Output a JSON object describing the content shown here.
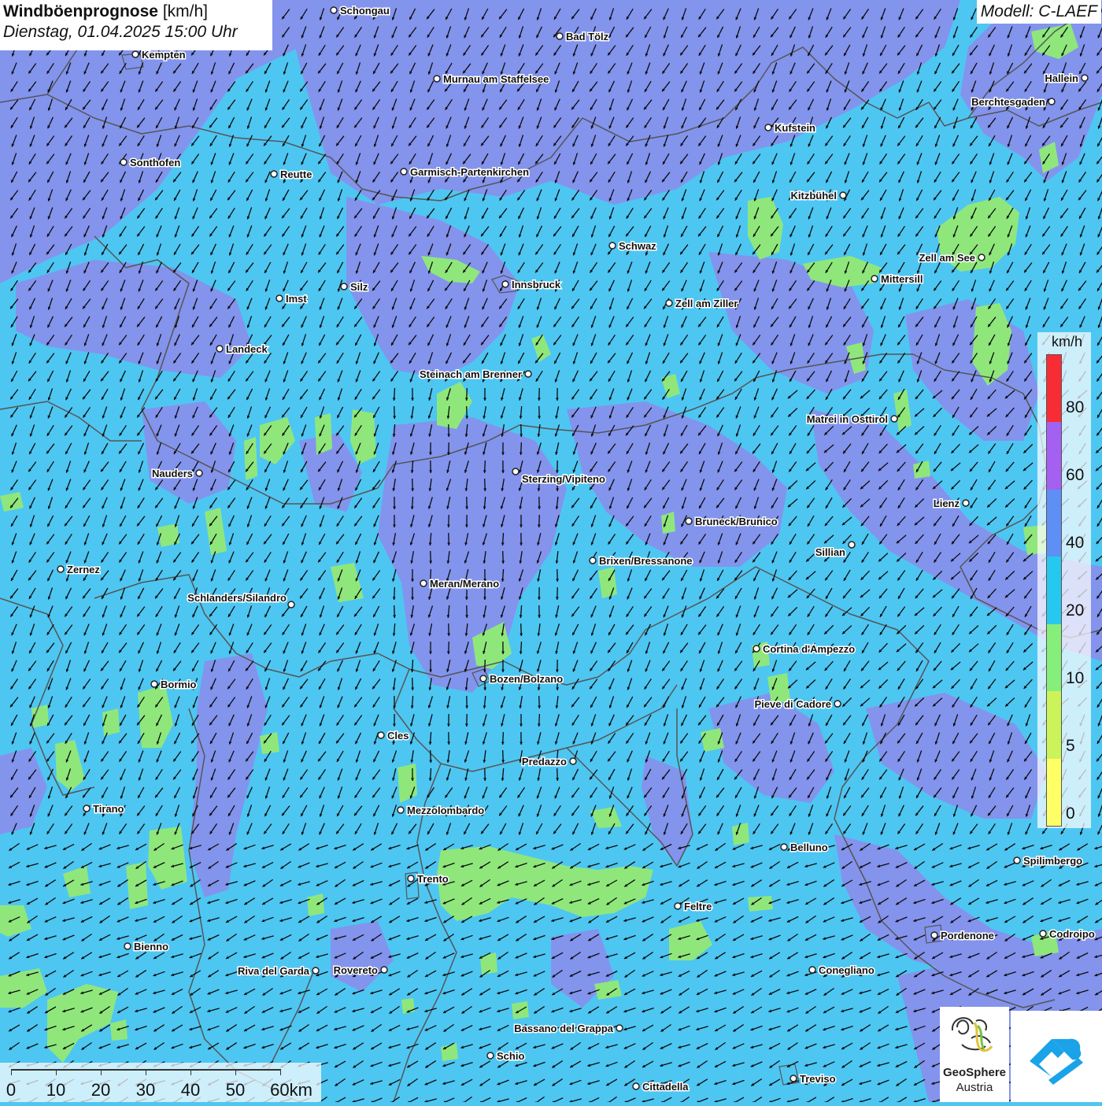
{
  "title": {
    "bold": "Windböenprognose",
    "unit": "[km/h]",
    "datetime": "Dienstag, 01.04.2025 15:00 Uhr"
  },
  "model": "Modell: C-LAEF",
  "legend": {
    "unit": "km/h",
    "labels": [
      "80",
      "60",
      "40",
      "20",
      "10",
      "5",
      "0"
    ],
    "segment_colors": [
      "#f72c35",
      "#a460f0",
      "#5d8ff5",
      "#27c8f0",
      "#86ee7a",
      "#cbf45a",
      "#ffff66"
    ]
  },
  "scale": {
    "labels": [
      "0",
      "10",
      "20",
      "30",
      "40",
      "50",
      "60km"
    ]
  },
  "colors": {
    "base": "#4ec6f2",
    "band_20_40": "#8a8eec",
    "band_10_20": "#8fe77c",
    "border": "#555555"
  },
  "wind_arrow_icon": "arrow-southwest",
  "logo": {
    "line1": "GeoSphere",
    "line2": "Austria"
  },
  "cities": [
    {
      "name": "Schongau"
    },
    {
      "name": "Bad Tölz"
    },
    {
      "name": "Kempten"
    },
    {
      "name": "Murnau am Staffelsee"
    },
    {
      "name": "Hallein"
    },
    {
      "name": "Berchtesgaden"
    },
    {
      "name": "Kufstein"
    },
    {
      "name": "Sonthofen"
    },
    {
      "name": "Reutte"
    },
    {
      "name": "Garmisch-Partenkirchen"
    },
    {
      "name": "Kitzbühel"
    },
    {
      "name": "Schwaz"
    },
    {
      "name": "Zell am See"
    },
    {
      "name": "Mittersill"
    },
    {
      "name": "Innsbruck"
    },
    {
      "name": "Imst"
    },
    {
      "name": "Silz"
    },
    {
      "name": "Zell am Ziller"
    },
    {
      "name": "Landeck"
    },
    {
      "name": "Steinach am Brenner"
    },
    {
      "name": "Matrei in Osttirol"
    },
    {
      "name": "Nauders"
    },
    {
      "name": "Sterzing/Vipiteno"
    },
    {
      "name": "Lienz"
    },
    {
      "name": "Bruneck/Brunico"
    },
    {
      "name": "Sillian"
    },
    {
      "name": "Zernez"
    },
    {
      "name": "Brixen/Bressanone"
    },
    {
      "name": "Meran/Merano"
    },
    {
      "name": "Schlanders/Silandro"
    },
    {
      "name": "Cortina d'Ampezzo"
    },
    {
      "name": "Bozen/Bolzano"
    },
    {
      "name": "Bormio"
    },
    {
      "name": "Pieve di Cadore"
    },
    {
      "name": "Cles"
    },
    {
      "name": "Predazzo"
    },
    {
      "name": "Tirano"
    },
    {
      "name": "Mezzolombardo"
    },
    {
      "name": "Belluno"
    },
    {
      "name": "Spilimbergo"
    },
    {
      "name": "Trento"
    },
    {
      "name": "Feltre"
    },
    {
      "name": "Pordenone"
    },
    {
      "name": "Codroipo"
    },
    {
      "name": "Bienno"
    },
    {
      "name": "Riva del Garda"
    },
    {
      "name": "Rovereto"
    },
    {
      "name": "Conegliano"
    },
    {
      "name": "Bassano del Grappa"
    },
    {
      "name": "Schio"
    },
    {
      "name": "Treviso"
    },
    {
      "name": "Cittadella"
    }
  ]
}
